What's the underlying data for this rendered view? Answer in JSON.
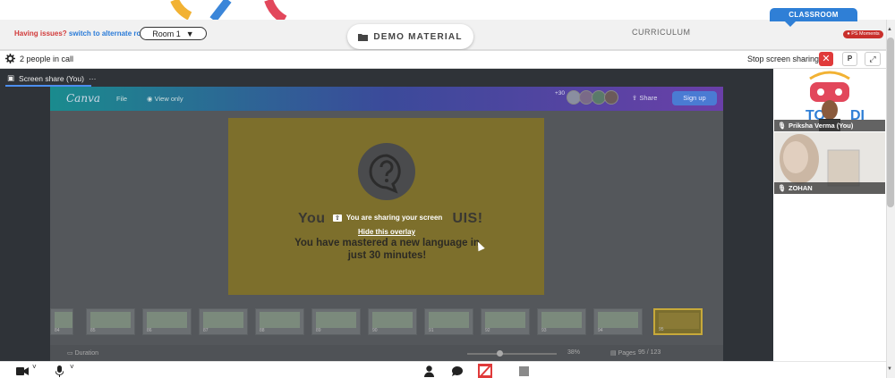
{
  "header": {
    "issues_label": "Having issues?",
    "alternate_link": "switch to alternate room",
    "room_select": "Room 1",
    "demo_material": "DEMO MATERIAL",
    "curriculum_tab": "CURRICULUM",
    "classroom_tab": "CLASSROOM",
    "ps_moments": "PS Moments"
  },
  "callbar": {
    "people_count": "2 people in call",
    "stop_sharing": "Stop screen sharing",
    "close_symbol": "✕",
    "p_button": "P",
    "expand_symbol": "⤢"
  },
  "stage": {
    "tab_label": "Screen share (You)",
    "more_symbol": "···"
  },
  "canva": {
    "logo": "Canva",
    "file_menu": "File",
    "view_only": "View only",
    "collaborator_count": "+30",
    "share_button": "Share",
    "signup_button": "Sign up",
    "slide_title": "You",
    "slide_title_tail": "UIS!",
    "slide_text": "You have mastered a new language in just 30 minutes!",
    "overlay_text": "You are sharing your screen",
    "hide_overlay": "Hide this overlay",
    "duration": "Duration",
    "zoom": "38%",
    "pages_label": "Pages",
    "page_count": "95 / 123",
    "thumbnail_numbers": [
      "84",
      "85",
      "86",
      "87",
      "88",
      "89",
      "90",
      "91",
      "92",
      "93",
      "94",
      "95"
    ]
  },
  "participants": [
    {
      "name": "Priksha Verma (You)"
    },
    {
      "name": "ZOHAN"
    }
  ],
  "colors": {
    "accent_blue": "#2f7fd6",
    "danger_red": "#e03a3a",
    "link_blue": "#2a7bd8"
  },
  "icons": [
    "gear-icon",
    "folder-icon",
    "screen-share-icon",
    "camera-icon",
    "mic-icon",
    "person-icon",
    "chat-icon",
    "whiteboard-icon",
    "stop-icon",
    "expand-icon",
    "question-icon"
  ]
}
